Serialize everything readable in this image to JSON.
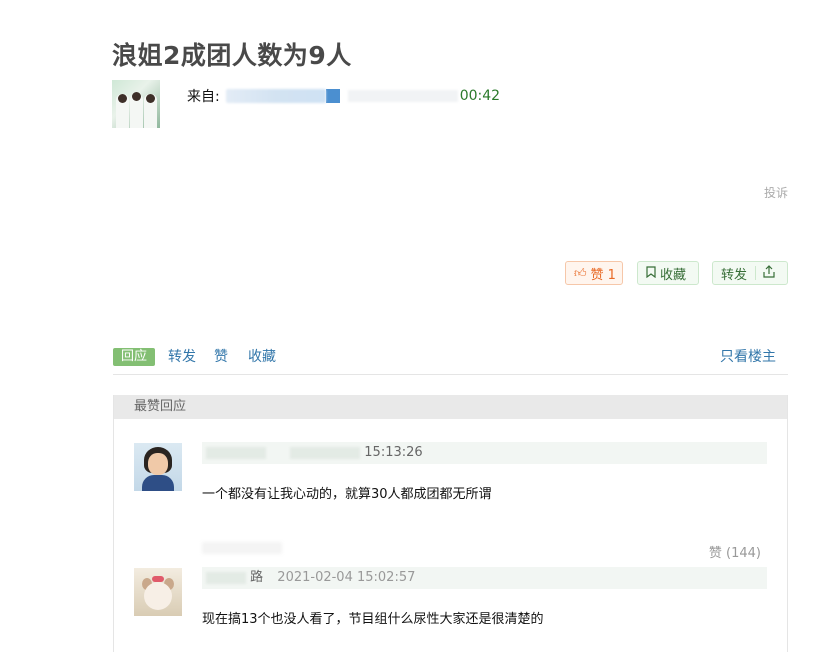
{
  "post": {
    "title": "浪姐2成团人数为9人",
    "from_label": "来自:",
    "time_fragment": "00:42",
    "report_label": "投诉"
  },
  "actions": {
    "like_label": "赞 1",
    "fav_label": "收藏",
    "share_label": "转发"
  },
  "tabs": {
    "reply": "回应",
    "forward": "转发",
    "like": "赞",
    "favorite": "收藏",
    "owner_only": "只看楼主"
  },
  "top_replies": {
    "header": "最赞回应",
    "comments": [
      {
        "time": "15:13:26",
        "text": "一个都没有让我心动的，就算30人都成团都无所谓"
      },
      {
        "name_fragment": "路",
        "time": "2021-02-04 15:02:57",
        "likes": "赞 (144)",
        "text": "现在搞13个也没人看了，节目组什么尿性大家还是很清楚的"
      }
    ]
  }
}
